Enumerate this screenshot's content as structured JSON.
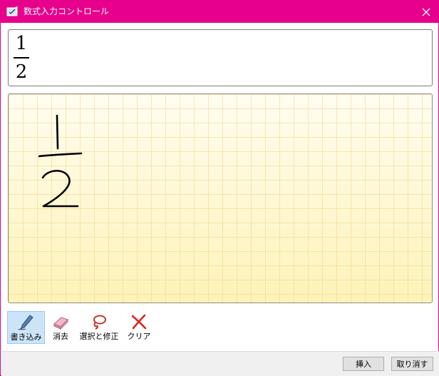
{
  "window": {
    "title": "数式入力コントロール",
    "accent_color": "#e6008c",
    "icons": {
      "app": "math-input-app-icon",
      "close": "close-icon"
    }
  },
  "preview": {
    "numerator": "1",
    "denominator": "2"
  },
  "ink": {
    "grid": true,
    "handwritten": "1/2"
  },
  "toolbar": {
    "items": [
      {
        "label": "書き込み",
        "icon": "pen-icon",
        "active": true
      },
      {
        "label": "消去",
        "icon": "eraser-icon",
        "active": false
      },
      {
        "label": "選択と修正",
        "icon": "lasso-icon",
        "active": false
      },
      {
        "label": "クリア",
        "icon": "clear-x-icon",
        "active": false
      }
    ]
  },
  "footer": {
    "insert_label": "挿入",
    "cancel_label": "取り消す"
  }
}
